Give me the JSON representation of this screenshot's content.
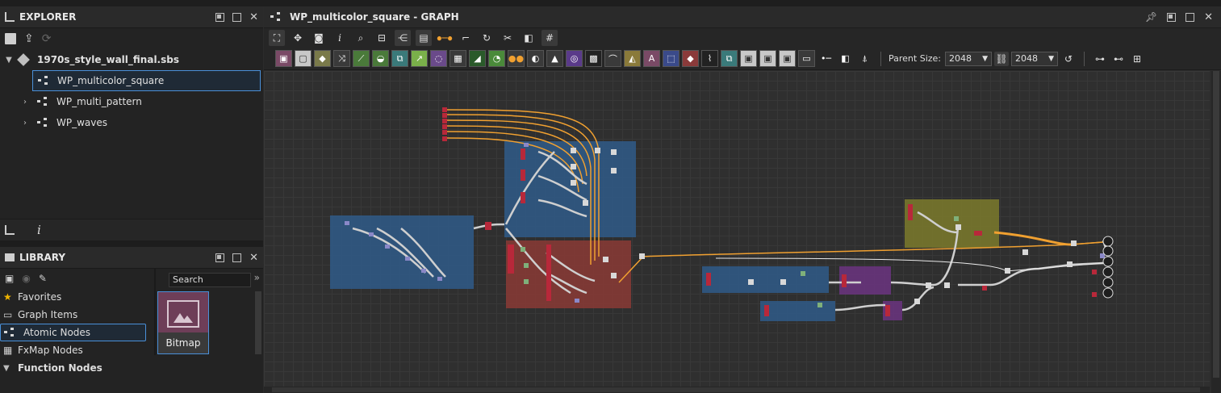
{
  "explorer": {
    "title": "EXPLORER",
    "package": "1970s_style_wall_final.sbs",
    "graphs": [
      {
        "label": "WP_multicolor_square",
        "selected": true
      },
      {
        "label": "WP_multi_pattern",
        "selected": false
      },
      {
        "label": "WP_waves",
        "selected": false
      }
    ]
  },
  "library": {
    "title": "LIBRARY",
    "search_placeholder": "Search",
    "categories": [
      {
        "label": "Favorites",
        "icon": "star-icon"
      },
      {
        "label": "Graph Items",
        "icon": "comment-icon"
      },
      {
        "label": "Atomic Nodes",
        "icon": "graph-icon",
        "selected": true
      },
      {
        "label": "FxMap Nodes",
        "icon": "grid-icon"
      },
      {
        "label": "Function Nodes",
        "icon": "function-icon",
        "expanded": true
      }
    ],
    "preview_item": {
      "label": "Bitmap",
      "icon": "image-icon"
    }
  },
  "graph": {
    "title": "WP_multicolor_square - GRAPH",
    "parent_size_label": "Parent Size:",
    "parent_size_w": "2048",
    "parent_size_h": "2048"
  },
  "colors": {
    "accent": "#4a90d9",
    "frame_blue": "#2f5a88",
    "frame_red": "#8a3a35",
    "frame_purple": "#6b3480",
    "frame_olive": "#7b7a2c",
    "link_orange": "#f0a030"
  }
}
